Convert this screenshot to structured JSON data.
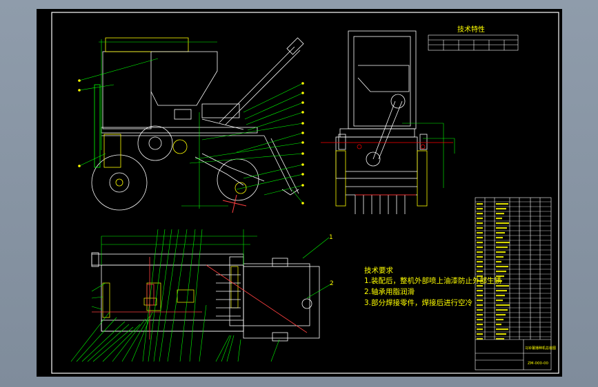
{
  "drawing": {
    "table_title": "技术特性",
    "requirements_heading": "技术要求",
    "requirements": [
      "1.装配后，整机外部喷上油漆防止外部生锈",
      "2.轴承用脂润滑",
      "3.部分焊接零件，焊接后进行空冷"
    ],
    "balloon_numbers": [
      "1",
      "2"
    ],
    "title_block": {
      "drawing_name": "马铃薯播种机总装图",
      "drawing_number": "ZM-000-00"
    }
  },
  "colors": {
    "background": "#000000",
    "frame": "#ffffff",
    "geometry_primary": "#ffffff",
    "geometry_secondary": "#ffff00",
    "leaders": "#00ff00",
    "dimensions": "#ff0000",
    "centerlines": "#ff4040",
    "text": "#ffff00"
  }
}
